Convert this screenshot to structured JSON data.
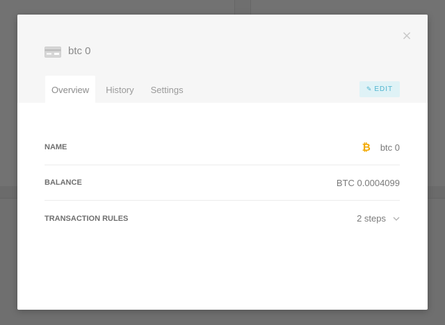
{
  "wallet": {
    "title": "btc 0",
    "icon": "wallet-card-icon",
    "close_icon": "close-icon",
    "close_glyph": "×"
  },
  "tabs": [
    {
      "label": "Overview",
      "active": true
    },
    {
      "label": "History",
      "active": false
    },
    {
      "label": "Settings",
      "active": false
    }
  ],
  "edit_button": {
    "label": "EDIT",
    "icon": "pencil-icon",
    "color": "#4fb4cf",
    "background": "#dff2f6"
  },
  "details": {
    "name": {
      "label": "NAME",
      "value": "btc 0",
      "icon": "bitcoin-icon",
      "icon_color": "#f2a900"
    },
    "balance": {
      "label": "BALANCE",
      "value": "BTC 0.0004099"
    },
    "transaction_rules": {
      "label": "TRANSACTION RULES",
      "value": "2 steps",
      "icon": "chevron-down-icon"
    }
  },
  "colors": {
    "overlay": "#6e6e6e",
    "header_bg": "#f6f6f6",
    "modal_bg": "#ffffff"
  }
}
